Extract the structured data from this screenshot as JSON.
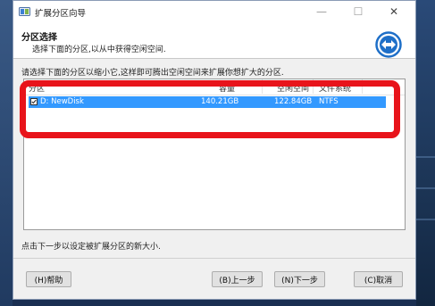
{
  "window": {
    "title": "扩展分区向导",
    "minimize_glyph": "—",
    "maximize_glyph": "☐",
    "close_glyph": "✕"
  },
  "header": {
    "title": "分区选择",
    "description": "选择下面的分区,以从中获得空闲空间."
  },
  "instruction": "请选择下面的分区以缩小它,这样即可腾出空闲空间来扩展你想扩大的分区.",
  "table": {
    "columns": [
      "分区",
      "容量",
      "空闲空间",
      "文件系统"
    ],
    "rows": [
      {
        "checked": true,
        "partition": "D: NewDisk",
        "capacity": "140.21GB",
        "free_space": "122.84GB",
        "file_system": "NTFS"
      }
    ]
  },
  "footnote": "点击下一步以设定被扩展分区的新大小.",
  "buttons": {
    "help": "(H)帮助",
    "back": "(B)上一步",
    "next": "(N)下一步",
    "cancel": "(C)取消"
  },
  "colors": {
    "highlight_border": "#e8141b",
    "selected_row": "#3399ff",
    "logo_blue": "#1e6fc8"
  },
  "icons": {
    "app": "partition-app-icon",
    "logo": "double-arrow-logo-icon"
  }
}
